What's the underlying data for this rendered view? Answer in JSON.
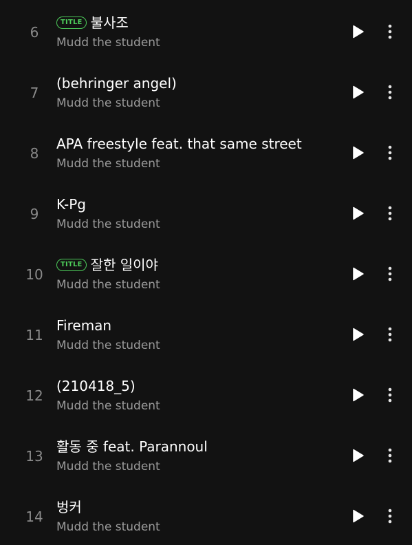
{
  "tracks": [
    {
      "number": "6",
      "badge": "TITLE",
      "title": "불사조",
      "artist": "Mudd the student"
    },
    {
      "number": "7",
      "badge": "",
      "title": "(behringer angel)",
      "artist": "Mudd the student"
    },
    {
      "number": "8",
      "badge": "",
      "title": "APA freestyle feat. that same street",
      "artist": "Mudd the student"
    },
    {
      "number": "9",
      "badge": "",
      "title": "K-Pg",
      "artist": "Mudd the student"
    },
    {
      "number": "10",
      "badge": "TITLE",
      "title": "잘한 일이야",
      "artist": "Mudd the student"
    },
    {
      "number": "11",
      "badge": "",
      "title": "Fireman",
      "artist": "Mudd the student"
    },
    {
      "number": "12",
      "badge": "",
      "title": "(210418_5)",
      "artist": "Mudd the student"
    },
    {
      "number": "13",
      "badge": "",
      "title": "활동 중 feat. Parannoul",
      "artist": "Mudd the student"
    },
    {
      "number": "14",
      "badge": "",
      "title": "벙커",
      "artist": "Mudd the student"
    }
  ],
  "icons": {
    "play": "play-icon",
    "more": "more-vertical-icon"
  },
  "colors": {
    "background": "#121212",
    "title_badge": "#4dcb5a",
    "track_number": "#8a8a8a",
    "artist_text": "#9b9b9b"
  }
}
